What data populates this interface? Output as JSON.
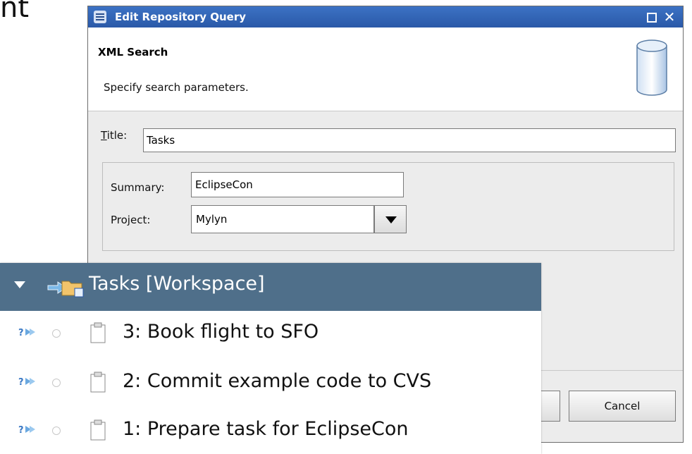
{
  "background": {
    "partial_text": "nt"
  },
  "dialog": {
    "title": "Edit Repository Query",
    "header": {
      "title": "XML Search",
      "description": "Specify search parameters."
    },
    "form": {
      "title_label": "itle:",
      "title_label_mnemonic": "T",
      "title_value": "Tasks",
      "summary_label": "Summary:",
      "summary_value": "EclipseCon",
      "project_label": "Project:",
      "project_value": "Mylyn"
    },
    "buttons": {
      "cancel": "Cancel"
    }
  },
  "tasks_view": {
    "header_label": "Tasks   [Workspace]",
    "items": [
      {
        "label": "3: Book flight to SFO"
      },
      {
        "label": "2: Commit example code to CVS"
      },
      {
        "label": "1: Prepare task for EclipseCon"
      }
    ]
  },
  "colors": {
    "titlebar": "#2a59a8",
    "tasks_header": "#4f6f8a",
    "dialog_bg": "#ececec"
  }
}
